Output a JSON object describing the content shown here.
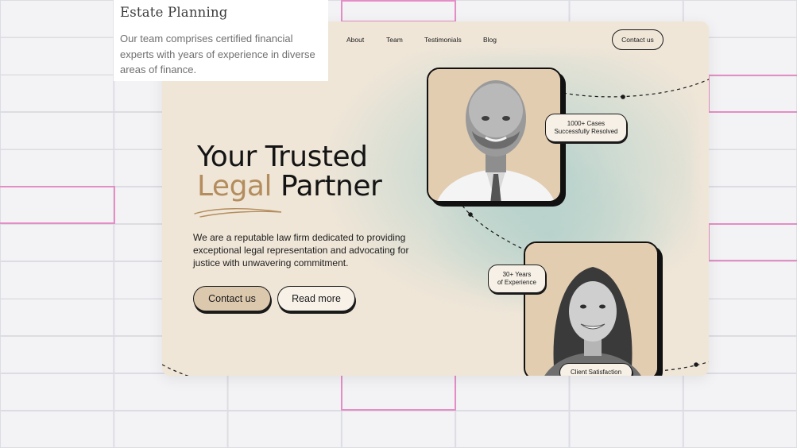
{
  "overlay": {
    "title": "Estate Planning",
    "text": "Our team comprises certified financial experts with years of experience in diverse areas of finance."
  },
  "nav": {
    "items": [
      "About",
      "Team",
      "Testimonials",
      "Blog"
    ],
    "contact": "Contact us"
  },
  "hero": {
    "headline_line1": "Your Trusted",
    "headline_accent": "Legal",
    "headline_rest": " Partner",
    "description": "We are a reputable law firm dedicated to providing exceptional legal representation and advocating for justice with unwavering commitment.",
    "primary_button": "Contact us",
    "secondary_button": "Read more"
  },
  "badges": {
    "cases_line1": "1000+ Cases",
    "cases_line2": "Successfully Resolved",
    "years_line1": "30+ Years",
    "years_line2": "of Experience",
    "satisfaction": "Client Satisfaction"
  },
  "colors": {
    "accent": "#b48d5e",
    "background": "#efe6d8",
    "teal_glow": "#9cc8c6",
    "grid_highlight": "#e58ec6"
  }
}
